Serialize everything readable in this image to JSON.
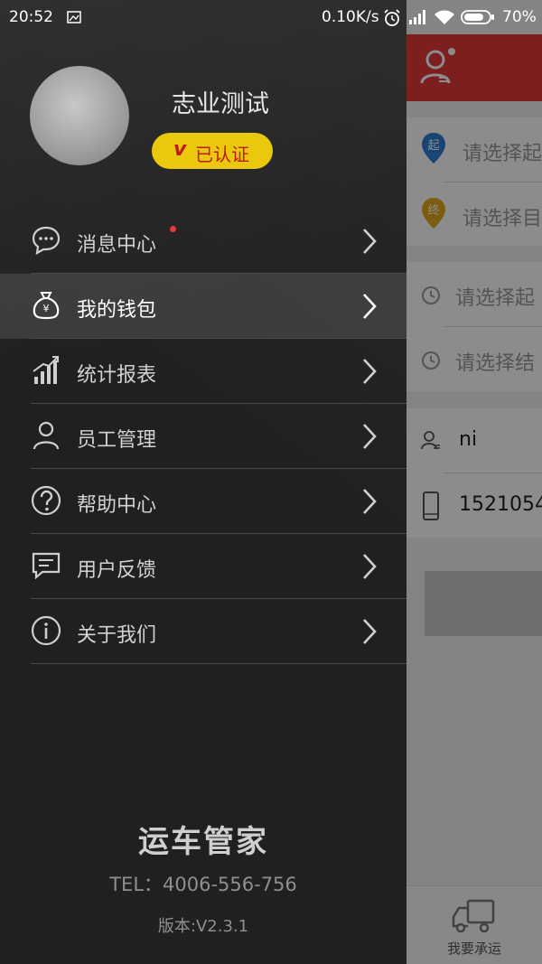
{
  "status_bar": {
    "time": "20:52",
    "network_speed": "0.10K/s",
    "battery": "70%"
  },
  "drawer": {
    "user_name": "志业测试",
    "badge_v": "v",
    "badge_text": "已认证",
    "menu": [
      {
        "label": "消息中心",
        "icon": "message-icon"
      },
      {
        "label": "我的钱包",
        "icon": "wallet-icon"
      },
      {
        "label": "统计报表",
        "icon": "chart-icon"
      },
      {
        "label": "员工管理",
        "icon": "person-icon"
      },
      {
        "label": "帮助中心",
        "icon": "help-icon"
      },
      {
        "label": "用户反馈",
        "icon": "feedback-icon"
      },
      {
        "label": "关于我们",
        "icon": "info-icon"
      }
    ],
    "brand": "运车管家",
    "tel": "TEL：4006-556-756",
    "version": "版本:V2.3.1"
  },
  "background_app": {
    "start_pin": "起",
    "end_pin": "终",
    "start_placeholder": "请选择起",
    "end_placeholder": "请选择目",
    "start_time_placeholder": "请选择起",
    "end_time_placeholder": "请选择结",
    "contact_name": "ni",
    "phone": "1521054",
    "bottom_tab": "我要承运"
  },
  "colors": {
    "header_red": "#e33a3a",
    "badge_yellow": "#e9c80d",
    "badge_text_red": "#c01818"
  }
}
